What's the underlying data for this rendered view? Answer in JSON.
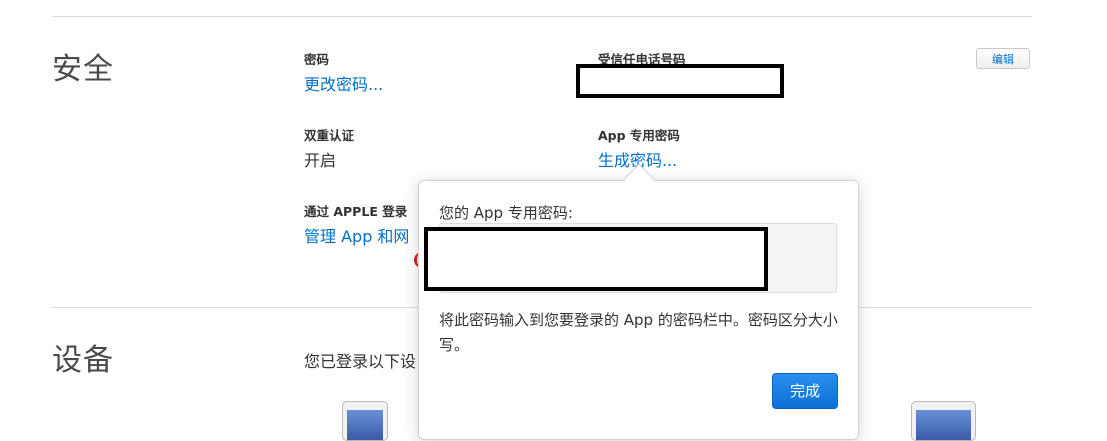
{
  "security": {
    "title": "安全",
    "edit_label": "编辑",
    "password": {
      "label": "密码",
      "link": "更改密码..."
    },
    "trusted_phone": {
      "label": "受信任电话号码"
    },
    "two_factor": {
      "label": "双重认证",
      "value": "开启"
    },
    "app_password": {
      "label": "App 专用密码",
      "link": "生成密码..."
    },
    "sign_in_apple": {
      "label": "通过 APPLE 登录",
      "link_visible": "管理 App 和网"
    }
  },
  "devices": {
    "title": "设备",
    "description_visible": "您已登录以下设"
  },
  "popover": {
    "label": "您的 App 专用密码:",
    "description": "将此密码输入到您要登录的 App 的密码栏中。密码区分大小写。",
    "done_label": "完成"
  }
}
